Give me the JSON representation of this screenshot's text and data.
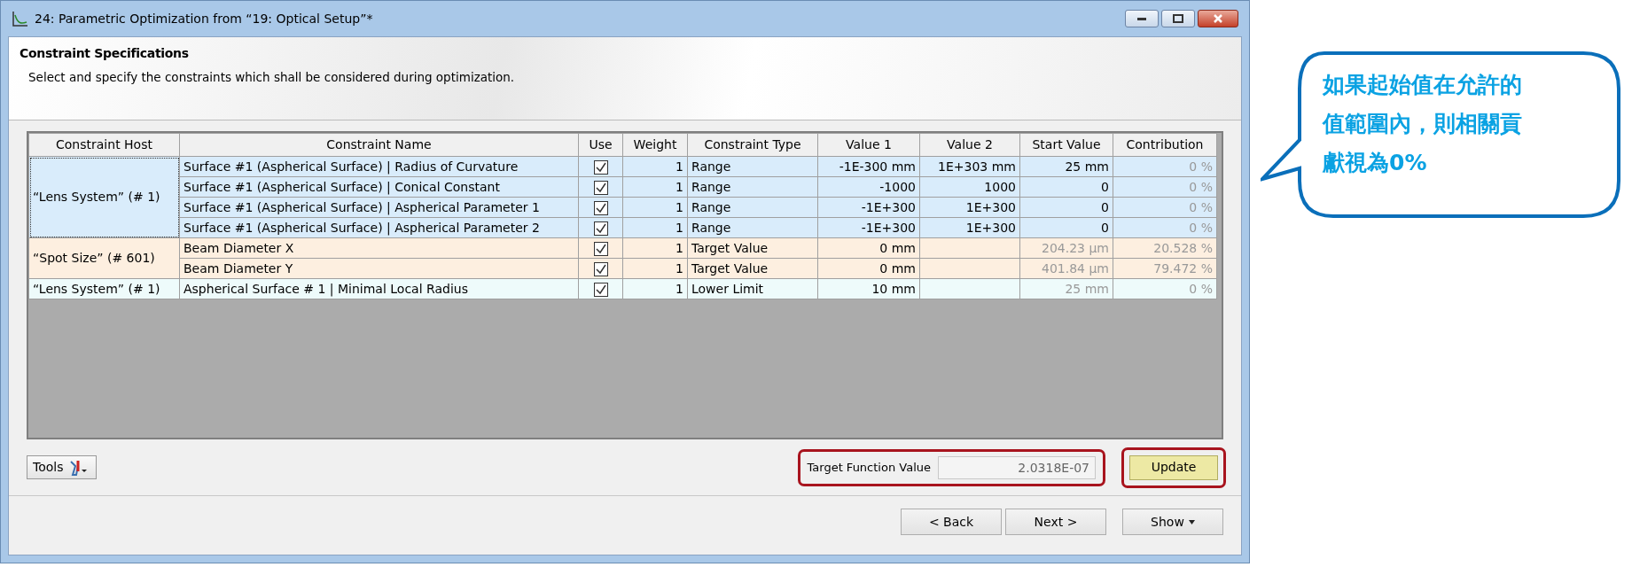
{
  "window": {
    "title": "24: Parametric Optimization from “19: Optical Setup”*"
  },
  "header": {
    "title": "Constraint Specifications",
    "description": "Select and specify the constraints which shall be considered during optimization."
  },
  "table": {
    "columns": [
      "Constraint Host",
      "Constraint Name",
      "Use",
      "Weight",
      "Constraint Type",
      "Value 1",
      "Value 2",
      "Start Value",
      "Contribution"
    ],
    "groups": [
      {
        "host": "“Lens System” (# 1)",
        "color": "#d9ecfb",
        "focused": true,
        "rows": [
          {
            "name": "Surface #1 (Aspherical Surface) | Radius of Curvature",
            "use": true,
            "weight": "1",
            "type": "Range",
            "value1": "-1E-300 mm",
            "value2": "1E+303 mm",
            "start": "25 mm",
            "start_dimmed": false,
            "contribution": "0 %"
          },
          {
            "name": "Surface #1 (Aspherical Surface) | Conical Constant",
            "use": true,
            "weight": "1",
            "type": "Range",
            "value1": "-1000",
            "value2": "1000",
            "start": "0",
            "start_dimmed": false,
            "contribution": "0 %"
          },
          {
            "name": "Surface #1 (Aspherical Surface) | Aspherical Parameter 1",
            "use": true,
            "weight": "1",
            "type": "Range",
            "value1": "-1E+300",
            "value2": "1E+300",
            "start": "0",
            "start_dimmed": false,
            "contribution": "0 %"
          },
          {
            "name": "Surface #1 (Aspherical Surface) | Aspherical Parameter 2",
            "use": true,
            "weight": "1",
            "type": "Range",
            "value1": "-1E+300",
            "value2": "1E+300",
            "start": "0",
            "start_dimmed": false,
            "contribution": "0 %"
          }
        ]
      },
      {
        "host": "“Spot Size” (# 601)",
        "color": "#fdefe0",
        "focused": false,
        "rows": [
          {
            "name": "Beam Diameter X",
            "use": true,
            "weight": "1",
            "type": "Target Value",
            "value1": "0 mm",
            "start": "204.23 µm",
            "start_dimmed": true,
            "contribution": "20.528 %"
          },
          {
            "name": "Beam Diameter Y",
            "use": true,
            "weight": "1",
            "type": "Target Value",
            "value1": "0 mm",
            "start": "401.84 µm",
            "start_dimmed": true,
            "contribution": "79.472 %"
          }
        ]
      },
      {
        "host": "“Lens System” (# 1)",
        "color": "#eefbfb",
        "focused": false,
        "rows": [
          {
            "name": "Aspherical Surface # 1 | Minimal Local Radius",
            "use": true,
            "weight": "1",
            "type": "Lower Limit",
            "value1": "10 mm",
            "start": "25 mm",
            "start_dimmed": true,
            "contribution": "0 %"
          }
        ]
      }
    ]
  },
  "tools_button": "Tools",
  "target_function": {
    "label": "Target Function Value",
    "value": "2.0318E-07",
    "highlighted": true
  },
  "update_button": {
    "label": "Update",
    "highlighted": true
  },
  "nav_buttons": [
    "< Back",
    "Next >",
    "Show"
  ],
  "callout": {
    "text": "如果起始值在允許的值範圍內，則相關貢獻視為0%"
  }
}
